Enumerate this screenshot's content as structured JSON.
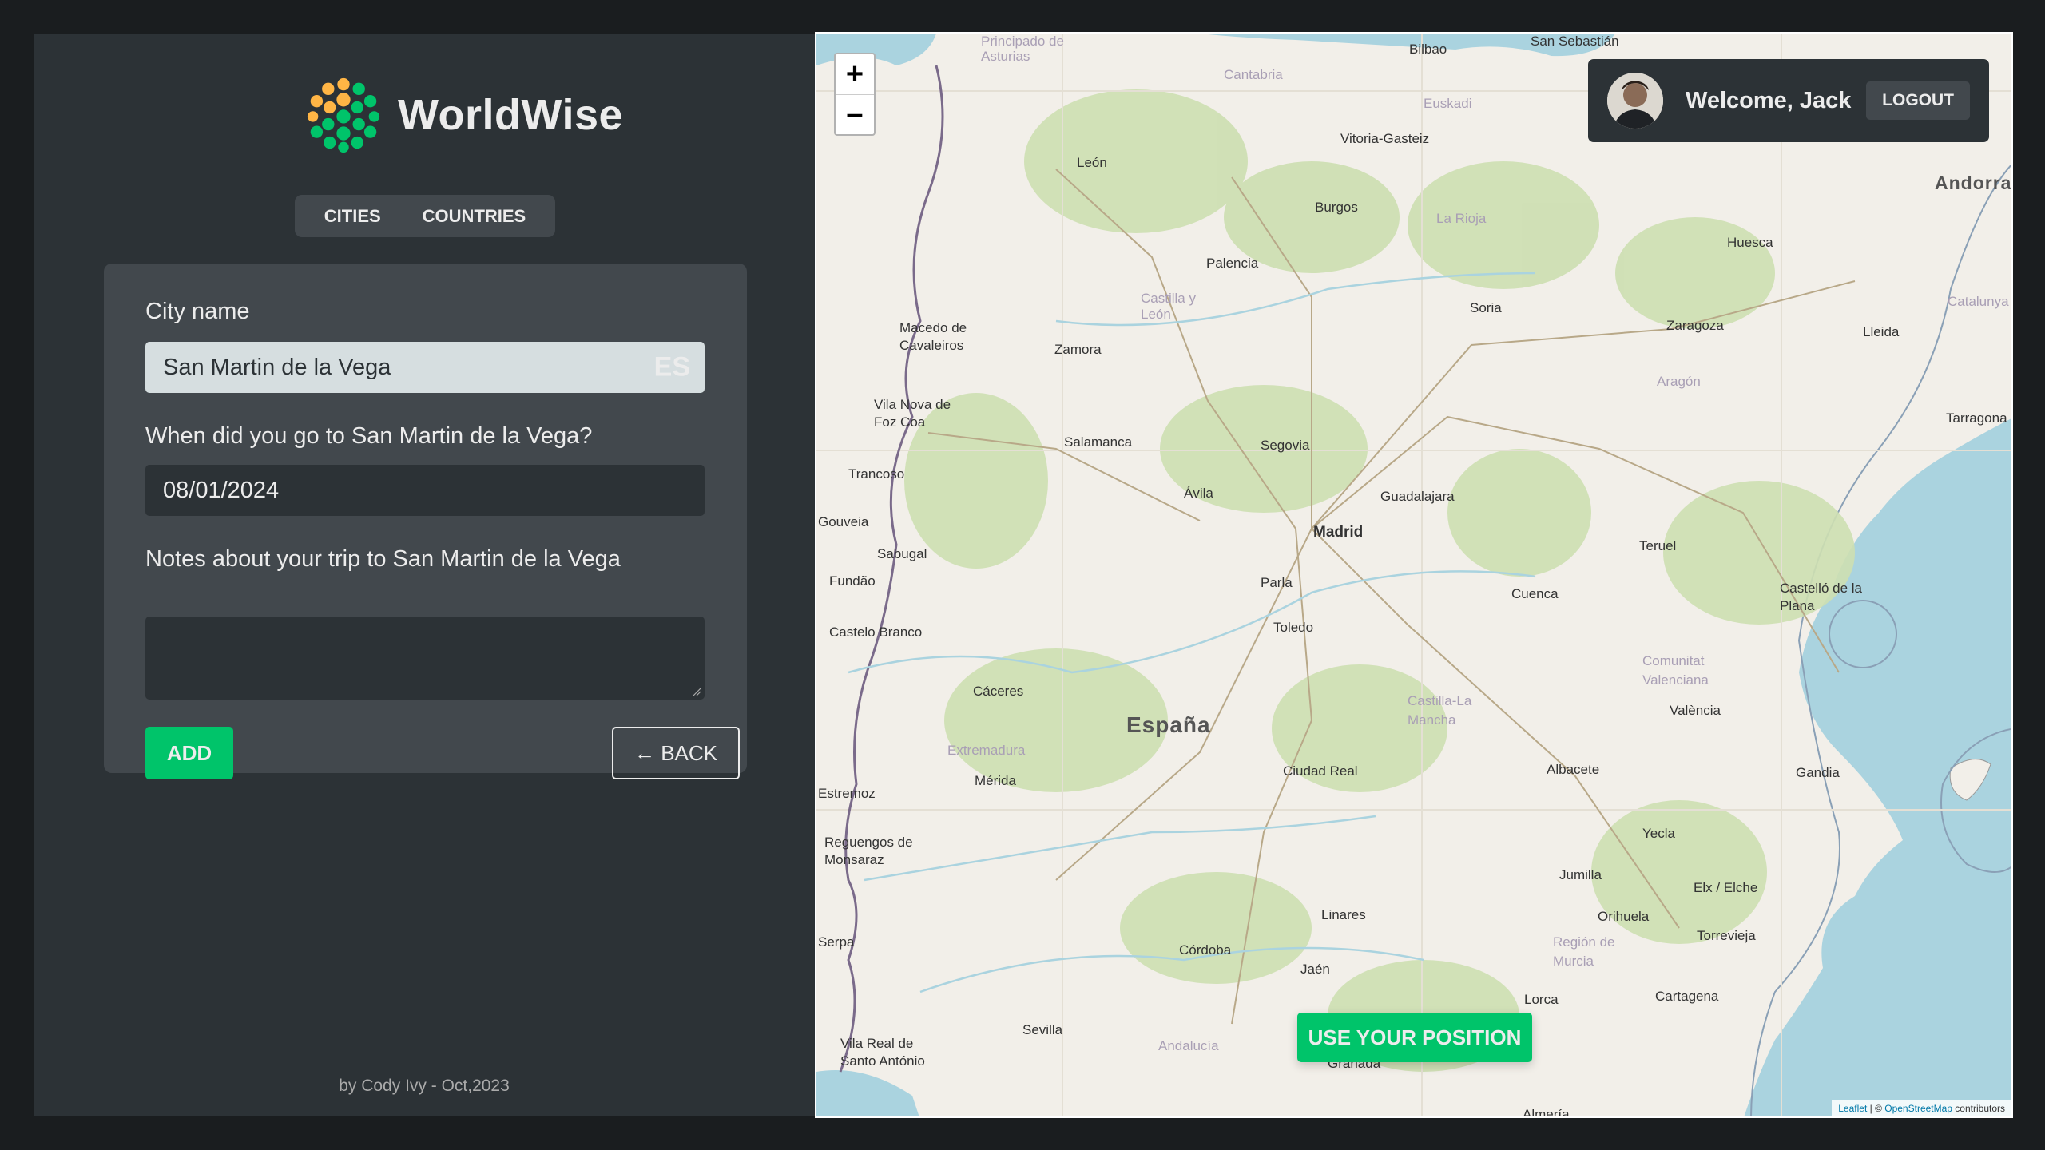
{
  "app": {
    "logo_text": "WorldWise",
    "tabs": [
      {
        "label": "CITIES"
      },
      {
        "label": "COUNTRIES"
      }
    ]
  },
  "form": {
    "city_label": "City name",
    "city_value": "San Martin de la Vega",
    "country_code": "ES",
    "date_label": "When did you go to San Martin de la Vega?",
    "date_value": "08/01/2024",
    "notes_label": "Notes about your trip to San Martin de la Vega",
    "notes_value": "",
    "add_label": "ADD",
    "back_label": "← BACK"
  },
  "footer": {
    "text": "by Cody Ivy - Oct,2023"
  },
  "map": {
    "zoom_in": "+",
    "zoom_out": "–",
    "user_greeting": "Welcome, Jack",
    "logout_label": "LOGOUT",
    "use_position_label": "USE YOUR POSITION",
    "attribution_leaflet": "Leaflet",
    "attribution_sep": " | © ",
    "attribution_osm": "OpenStreetMap",
    "attribution_suffix": " contributors",
    "country_label": "España",
    "places": [
      "Principado de Asturias",
      "Cantabria",
      "Bilbao",
      "San Sebastián",
      "Euskadi",
      "Vitoria-Gasteiz",
      "Andorra",
      "León",
      "Burgos",
      "La Rioja",
      "Huesca",
      "Palencia",
      "Castilla y León",
      "Soria",
      "Zaragoza",
      "Lleida",
      "Macedo de Cavaleiros",
      "Zamora",
      "Aragón",
      "Catalunya",
      "Vila Nova de Foz Coa",
      "Tarragona",
      "Salamanca",
      "Segovia",
      "Trancoso",
      "Ávila",
      "Guadalajara",
      "Madrid",
      "Gouveia",
      "Sabugal",
      "Teruel",
      "Parla",
      "Fundão",
      "Cuenca",
      "Castelló de la Plana",
      "Toledo",
      "Castelo Branco",
      "Comunitat Valenciana",
      "Cáceres",
      "Castilla-La Mancha",
      "València",
      "Extremadura",
      "Ciudad Real",
      "Albacete",
      "Gandia",
      "Mérida",
      "Estremoz",
      "Reguengos de Monsaraz",
      "Yecla",
      "Jumilla",
      "Elx / Elche",
      "Orihuela",
      "Linares",
      "Torrevieja",
      "Córdoba",
      "Región de Murcia",
      "Jaén",
      "Lorca",
      "Cartagena",
      "Serpa",
      "Sevilla",
      "Andalucía",
      "Vila Real de Santo António",
      "Granada",
      "Almería"
    ]
  }
}
